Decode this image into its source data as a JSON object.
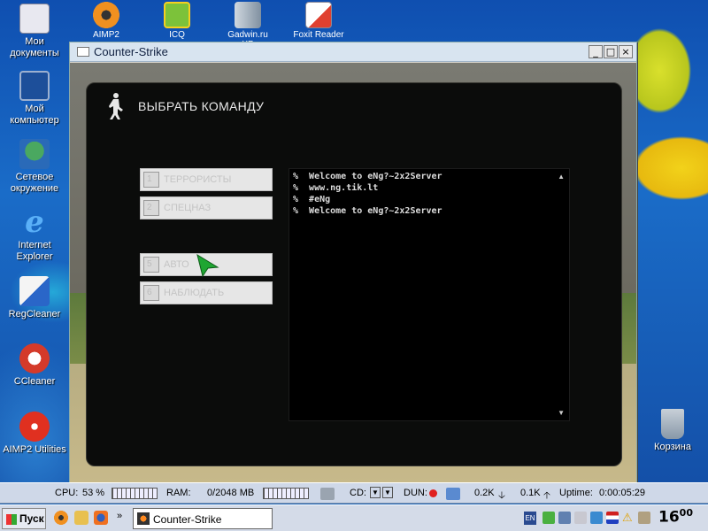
{
  "desktop_icons": [
    {
      "label_line1": "Мои",
      "label_line2": "документы",
      "icon": "my-documents-icon",
      "color": "#e8e8f0"
    },
    {
      "label_line1": "Мой",
      "label_line2": "компьютер",
      "icon": "my-computer-icon",
      "color": "#3070c0"
    },
    {
      "label_line1": "Сетевое",
      "label_line2": "окружение",
      "icon": "network-icon",
      "color": "#2f8a4a"
    },
    {
      "label_line1": "Internet",
      "label_line2": "Explorer",
      "icon": "ie-icon",
      "color": "#3a7ad8"
    },
    {
      "label_line1": "RegCleaner",
      "label_line2": "",
      "icon": "regcleaner-icon",
      "color": "#e8e8e8"
    },
    {
      "label_line1": "CCleaner",
      "label_line2": "",
      "icon": "ccleaner-icon",
      "color": "#d43a2a"
    },
    {
      "label_line1": "AIMP2 Utilities",
      "label_line2": "",
      "icon": "aimp-utilities-icon",
      "color": "#e03020"
    }
  ],
  "top_icons": [
    {
      "label": "AIMP2",
      "icon": "aimp-icon",
      "color": "#f09020"
    },
    {
      "label": "ICQ",
      "icon": "icq-icon",
      "color": "#7cc23a"
    },
    {
      "label": "Gadwin.ru XP",
      "icon": "server-icon",
      "color": "#b0b8c8"
    },
    {
      "label": "Foxit Reader",
      "icon": "foxit-icon",
      "color": "#e8e8f8"
    }
  ],
  "recycle_bin": {
    "label": "Корзина",
    "icon": "recycle-bin-icon"
  },
  "window": {
    "title": "Counter-Strike",
    "minimize": "_",
    "maximize": "□",
    "close": "×"
  },
  "game_menu": {
    "title": "ВЫБРАТЬ КОМАНДУ",
    "team_buttons": [
      {
        "num": "1",
        "label": "ТЕРРОРИСТЫ"
      },
      {
        "num": "2",
        "label": "СПЕЦНАЗ"
      },
      {
        "num": "5",
        "label": "АВТО"
      },
      {
        "num": "6",
        "label": "НАБЛЮДАТЬ"
      }
    ],
    "console_lines": [
      "%  Welcome to eNg?~2x2Server",
      "%  www.ng.tik.lt",
      "%  #eNg",
      "%  Welcome to eNg?~2x2Server"
    ]
  },
  "monitor_bar": {
    "cpu_label": "CPU:",
    "cpu_value": "53 %",
    "cpu_load": 0.53,
    "ram_label": "RAM:",
    "ram_value": "0/2048 MB",
    "cd_label": "CD:",
    "dun_label": "DUN:",
    "down_rate": "0.2K",
    "up_rate": "0.1K",
    "uptime_label": "Uptime:",
    "uptime_value": "0:00:05:29"
  },
  "taskbar": {
    "start_label": "Пуск",
    "task_title": "Counter-Strike",
    "lang": "EN",
    "clock": "16",
    "clock_minutes": "00"
  }
}
